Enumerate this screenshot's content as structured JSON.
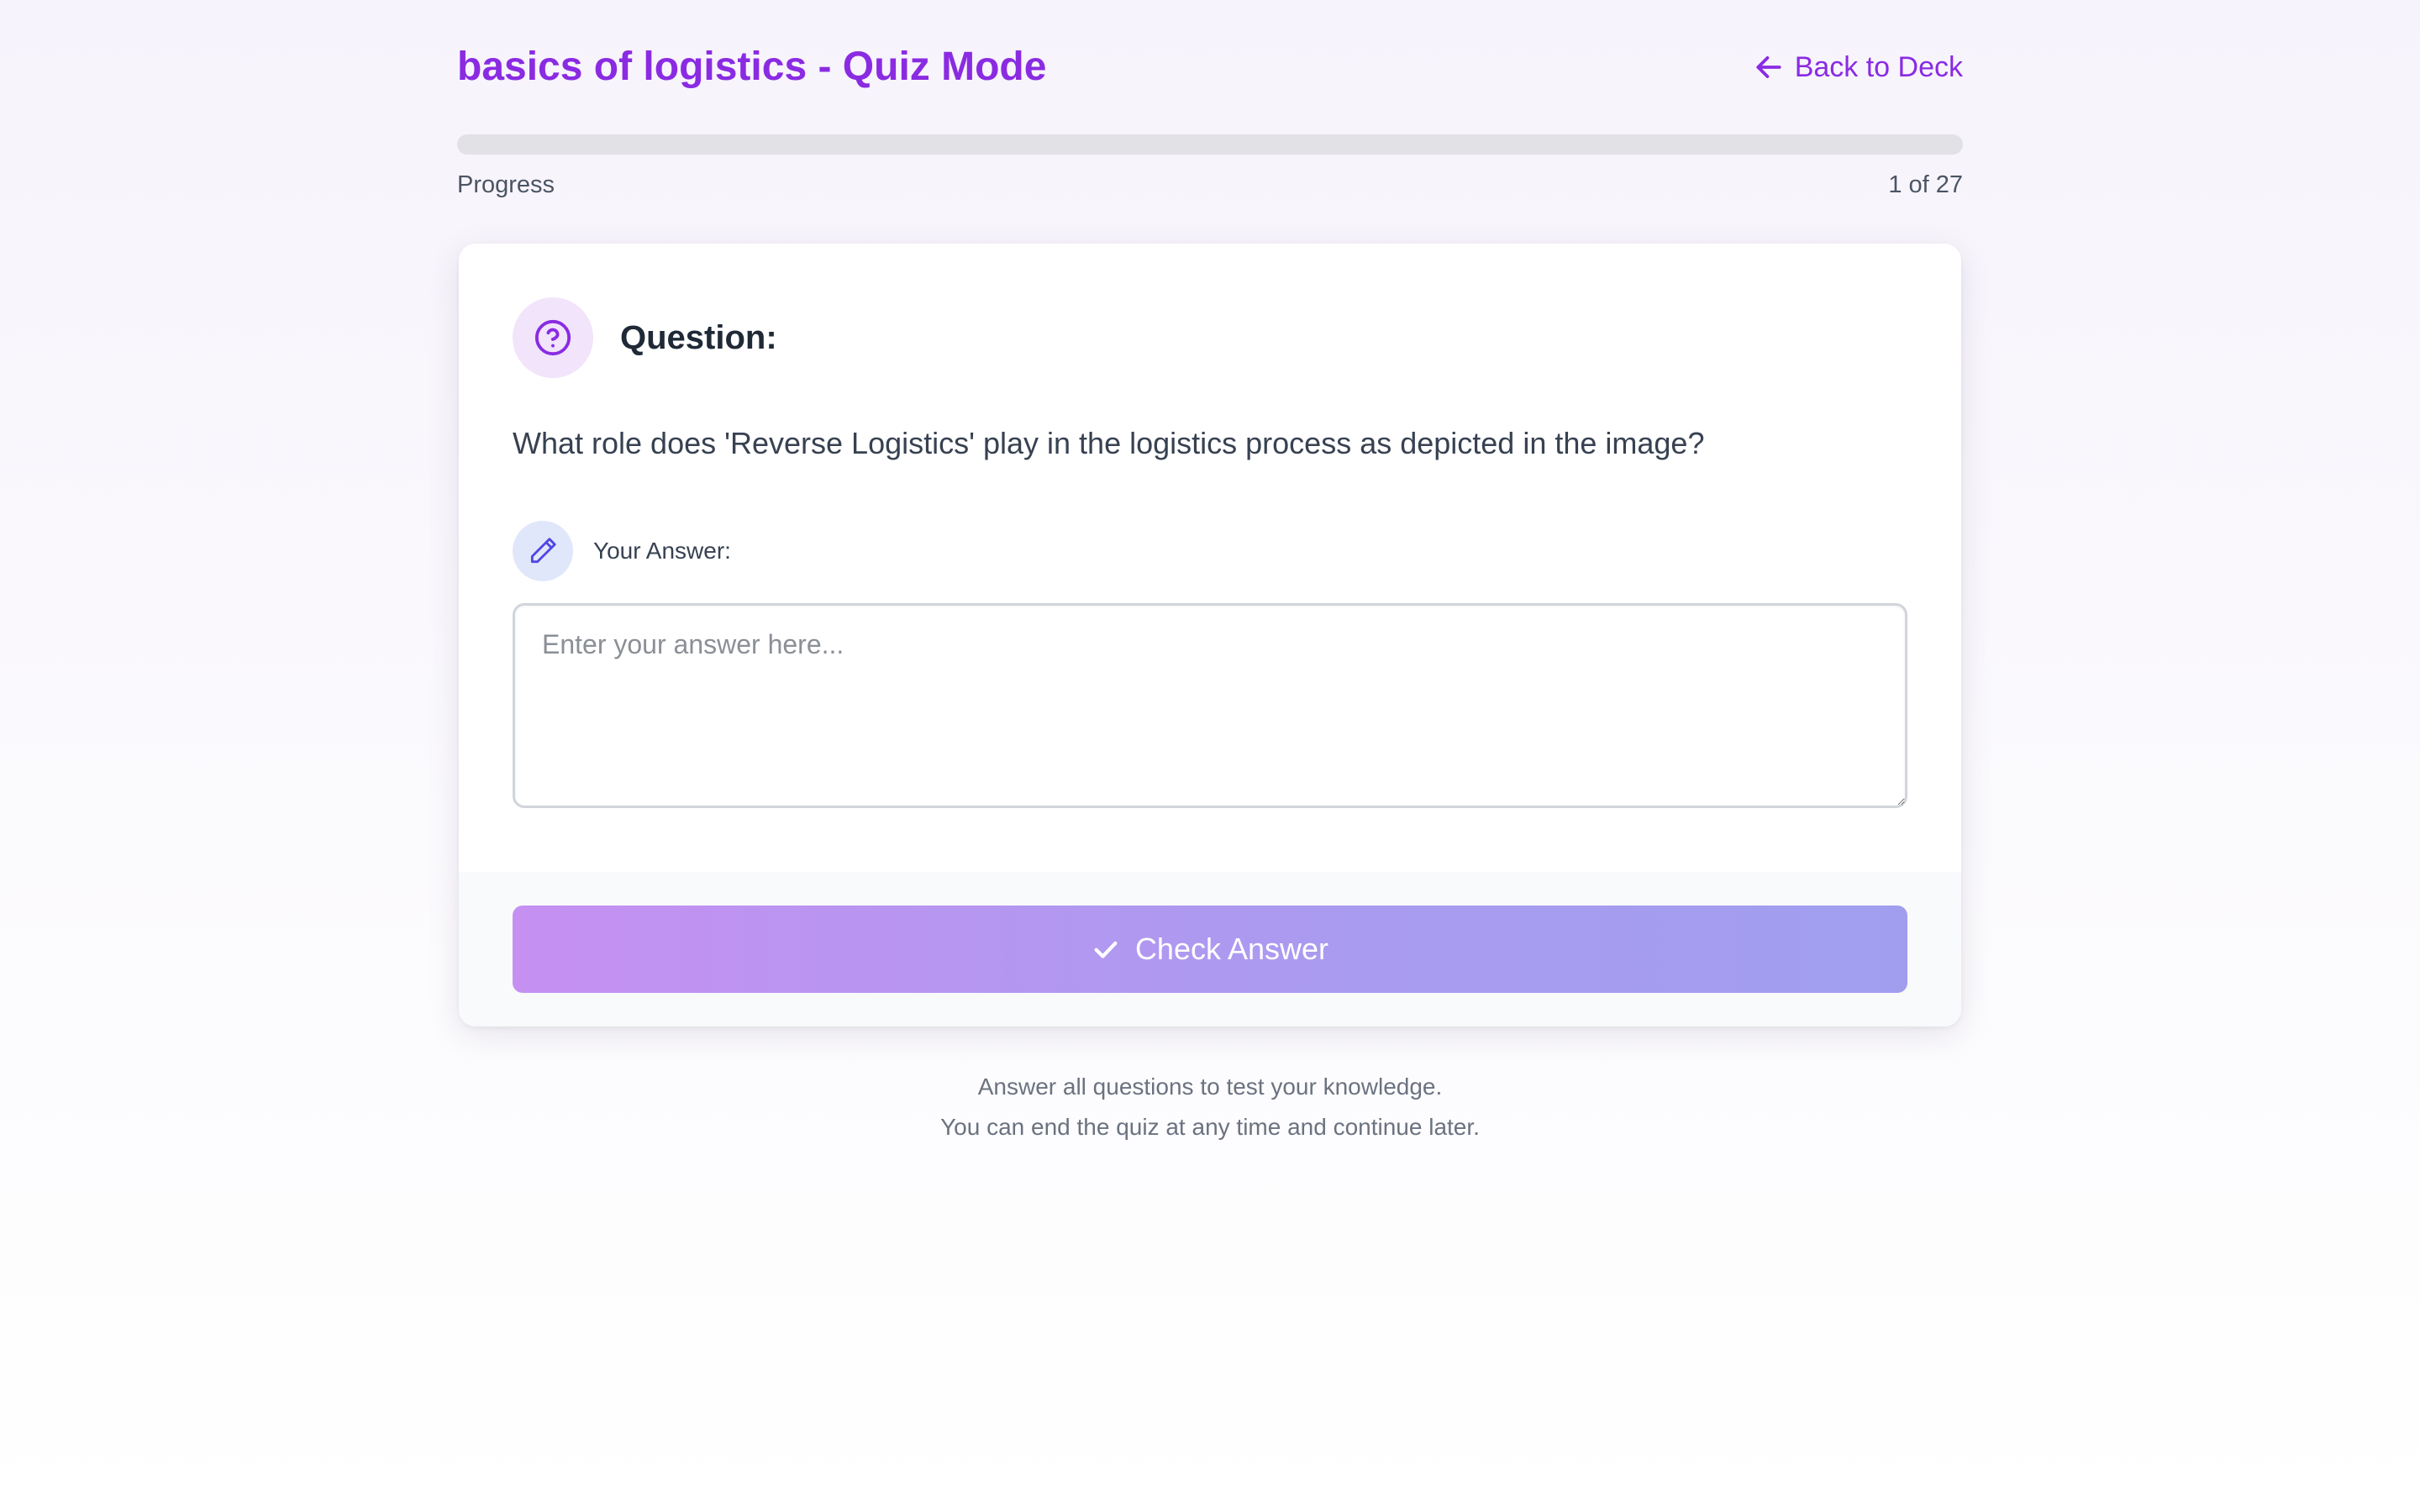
{
  "header": {
    "title": "basics of logistics - Quiz Mode",
    "back_label": "Back to Deck",
    "back_icon": "arrow-left-icon"
  },
  "progress": {
    "label": "Progress",
    "current": 1,
    "total": 27,
    "count_text": "1 of 27",
    "fill_fraction": 0
  },
  "question": {
    "icon": "question-circle-icon",
    "heading": "Question:",
    "text": "What role does 'Reverse Logistics' play in the logistics process as depicted in the image?"
  },
  "answer": {
    "icon": "pencil-icon",
    "label": "Your Answer:",
    "value": "",
    "placeholder": "Enter your answer here..."
  },
  "actions": {
    "check_label": "Check Answer",
    "check_icon": "checkmark-icon"
  },
  "footer": {
    "line1": "Answer all questions to test your knowledge.",
    "line2": "You can end the quiz at any time and continue later."
  },
  "colors": {
    "accent": "#8a2be2",
    "button_gradient_start": "#c590f2",
    "button_gradient_end": "#a19ef0",
    "question_icon_bg": "#f1e4fb",
    "answer_icon_bg": "#e0e7fb"
  }
}
